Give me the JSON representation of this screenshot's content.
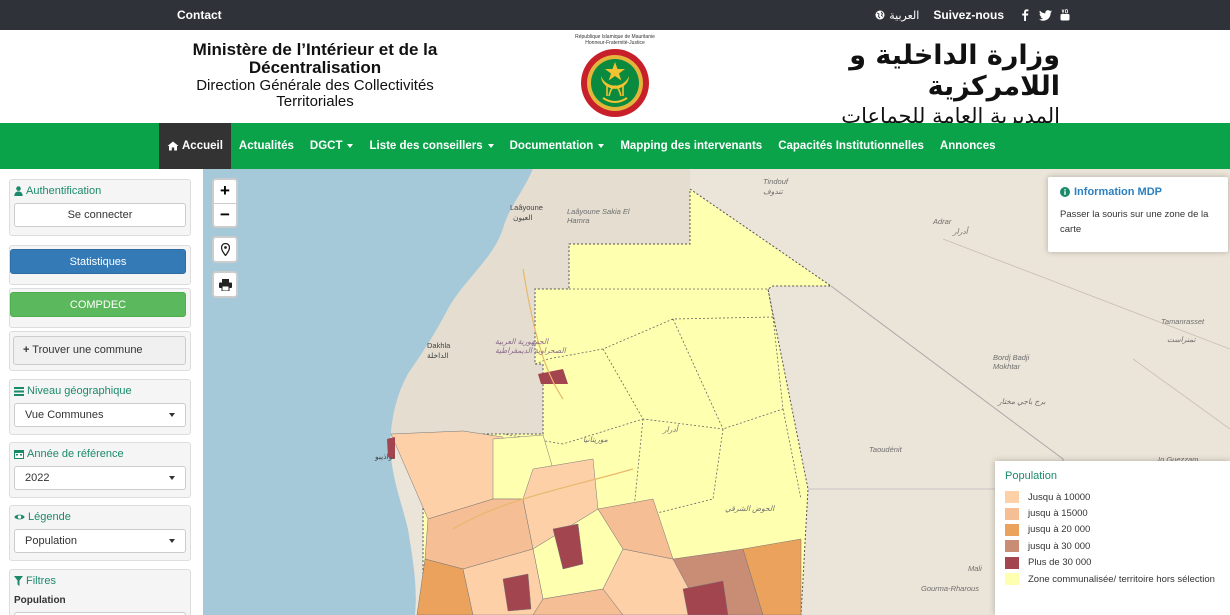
{
  "topbar": {
    "contact": "Contact",
    "lang_label": "العربية",
    "follow_label": "Suivez-nous",
    "social": [
      "facebook-icon",
      "twitter-icon",
      "youtube-icon"
    ]
  },
  "header": {
    "fr_line1": "Ministère de l’Intérieur et de la",
    "fr_line2": "Décentralisation",
    "fr_line3": "Direction Générale des Collectivités",
    "fr_line4": "Territoriales",
    "seal_line1": "République Islamique de Mauritanie",
    "seal_line2": "Honneur-Fraternité-Justice",
    "ar_line1": "وزارة الداخلية و اللامركزية",
    "ar_line2": "المديرية العامة للجماعات الإقليمية"
  },
  "nav": {
    "items": [
      {
        "label": "Accueil",
        "active": true,
        "dropdown": false
      },
      {
        "label": "Actualités",
        "active": false,
        "dropdown": false
      },
      {
        "label": "DGCT",
        "active": false,
        "dropdown": true
      },
      {
        "label": "Liste des conseillers",
        "active": false,
        "dropdown": true
      },
      {
        "label": "Documentation",
        "active": false,
        "dropdown": true
      },
      {
        "label": "Mapping des intervenants",
        "active": false,
        "dropdown": false
      },
      {
        "label": "Capacités Institutionnelles",
        "active": false,
        "dropdown": false
      },
      {
        "label": "Annonces",
        "active": false,
        "dropdown": false
      }
    ]
  },
  "sidebar": {
    "auth_title": "Authentification",
    "connect_label": "Se connecter",
    "stats_label": "Statistiques",
    "compdec_label": "COMPDEC",
    "find_label": "Trouver une commune",
    "geo_title": "Niveau géographique",
    "geo_value": "Vue Communes",
    "year_title": "Année de référence",
    "year_value": "2022",
    "legend_title": "Légende",
    "legend_value": "Population",
    "filters_title": "Filtres",
    "filters_sub": "Population"
  },
  "map": {
    "zoom_in": "+",
    "zoom_out": "−",
    "info_title": "Information MDP",
    "info_body": "Passer la souris sur une zone de la carte",
    "legend_title": "Population",
    "legend_items": [
      {
        "label": "Jusqu à 10000",
        "color": "#fdd0a8"
      },
      {
        "label": "jusqu à 15000",
        "color": "#f6be95"
      },
      {
        "label": "jusqu à 20 000",
        "color": "#eba25c"
      },
      {
        "label": "jusqu à 30 000",
        "color": "#c98c74"
      },
      {
        "label": "Plus de 30 000",
        "color": "#a2454f"
      },
      {
        "label": "Zone communalisée/ territoire hors sélection",
        "color": "#ffffb0"
      }
    ],
    "place_labels": [
      {
        "text": "Tindouf"
      },
      {
        "text": "تندوف"
      },
      {
        "text": "Laâyoune"
      },
      {
        "text": "العيون"
      },
      {
        "text": "Laâyoune Sakia El Hamra"
      },
      {
        "text": "Dakhla"
      },
      {
        "text": "الداخلة"
      },
      {
        "text": "الجمهورية العربية الصحراوية الديمقراطية"
      },
      {
        "text": "Adrar"
      },
      {
        "text": "أدرار"
      },
      {
        "text": "Tamanrasset"
      },
      {
        "text": "تمنراست"
      },
      {
        "text": "Bordj Badji Mokhtar"
      },
      {
        "text": "برج باجي مختار"
      },
      {
        "text": "Taoudénit"
      },
      {
        "text": "In Guezzam"
      },
      {
        "text": "Gourma-Rharous"
      },
      {
        "text": "موريتانيا"
      },
      {
        "text": "أدرار"
      },
      {
        "text": "الحوض الشرقي"
      },
      {
        "text": "نواذيبو"
      },
      {
        "text": "Mali"
      }
    ]
  }
}
